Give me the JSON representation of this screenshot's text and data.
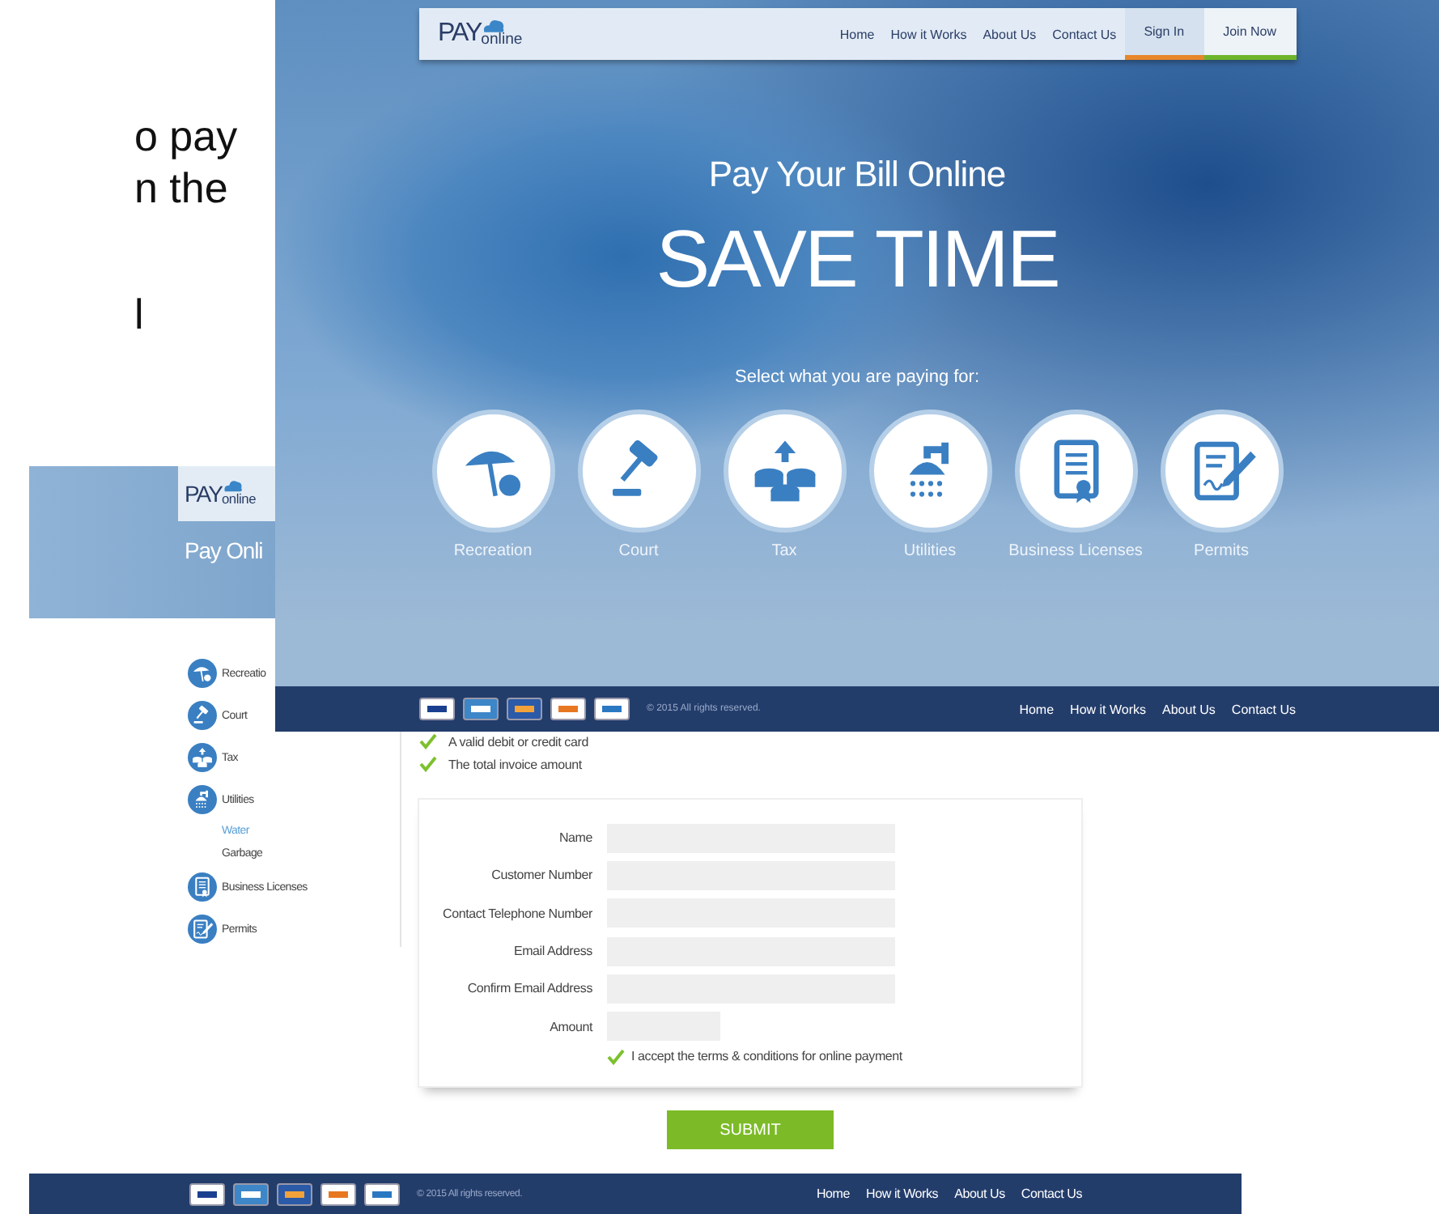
{
  "slide_text": [
    "o pay",
    "n the",
    "l"
  ],
  "back_page": {
    "logo": {
      "word": "PAY",
      "suffix": "online"
    },
    "title": "Pay Onli",
    "sidebar": {
      "items": [
        {
          "label": "Recreatio",
          "kind": "umbrella",
          "selected": false
        },
        {
          "label": "Court",
          "kind": "gavel",
          "selected": false
        },
        {
          "label": "Tax",
          "kind": "coins",
          "selected": false
        },
        {
          "label": "Utilities",
          "kind": "shower",
          "selected": false,
          "children": [
            {
              "label": "Water",
              "selected": true
            },
            {
              "label": "Garbage",
              "selected": false
            }
          ]
        },
        {
          "label": "Business Licenses",
          "kind": "certificate",
          "selected": false
        },
        {
          "label": "Permits",
          "kind": "permit",
          "selected": false
        }
      ]
    },
    "checklist": [
      {
        "text": "A valid debit or credit card",
        "checked": true
      },
      {
        "text": "The total invoice amount",
        "checked": true
      }
    ],
    "form": {
      "fields": [
        {
          "label": "Name",
          "kind": "wide"
        },
        {
          "label": "Customer Number",
          "kind": "wide"
        },
        {
          "label": "Contact Telephone Number",
          "kind": "wide"
        },
        {
          "label": "Email Address",
          "kind": "wide"
        },
        {
          "label": "Confirm Email Address",
          "kind": "wide"
        },
        {
          "label": "Amount",
          "kind": "short"
        }
      ],
      "terms": {
        "text": "I accept the terms & conditions for online payment",
        "checked": true
      },
      "submit": "SUBMIT"
    },
    "footer": {
      "copyright": "© 2015 All rights reserved.",
      "links": [
        "Home",
        "How it Works",
        "About Us",
        "Contact Us"
      ]
    }
  },
  "front_page": {
    "logo": {
      "word": "PAY",
      "suffix": "online"
    },
    "nav": [
      {
        "label": "Home",
        "kind": "link"
      },
      {
        "label": "How it Works",
        "kind": "link"
      },
      {
        "label": "About Us",
        "kind": "link"
      },
      {
        "label": "Contact Us",
        "kind": "link"
      },
      {
        "label": "Sign In",
        "kind": "signin"
      },
      {
        "label": "Join Now",
        "kind": "join"
      }
    ],
    "subtitle": "Pay Your Bill Online",
    "headline": "SAVE TIME",
    "prompt": "Select what you are paying for:",
    "categories": [
      {
        "label": "Recreation",
        "kind": "umbrella"
      },
      {
        "label": "Court",
        "kind": "gavel"
      },
      {
        "label": "Tax",
        "kind": "coins"
      },
      {
        "label": "Utilities",
        "kind": "shower"
      },
      {
        "label": "Business Licenses",
        "kind": "certificate"
      },
      {
        "label": "Permits",
        "kind": "permit"
      }
    ],
    "footer": {
      "copyright": "© 2015 All rights reserved.",
      "links": [
        "Home",
        "How it Works",
        "About Us",
        "Contact Us"
      ]
    }
  }
}
